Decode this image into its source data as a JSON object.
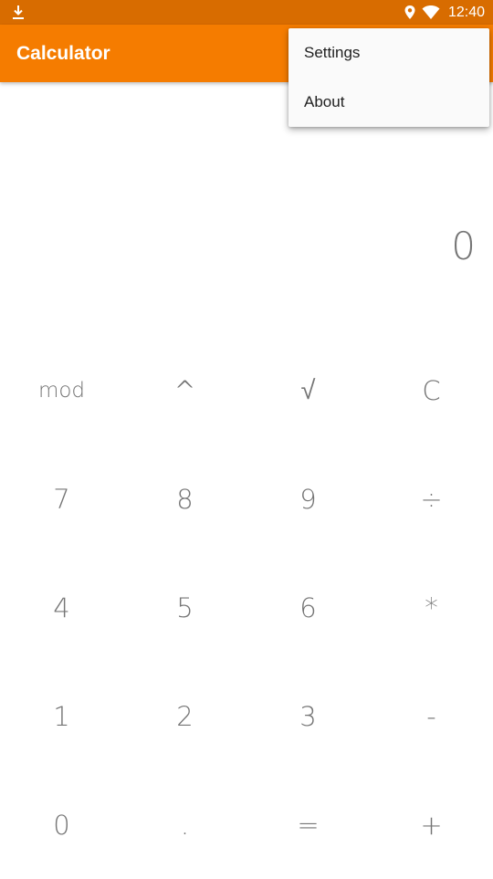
{
  "status_bar": {
    "time": "12:40",
    "icons": [
      "download-icon",
      "location-icon",
      "wifi-icon"
    ]
  },
  "app_bar": {
    "title": "Calculator",
    "color": "#f57c00"
  },
  "menu": {
    "items": [
      {
        "label": "Settings"
      },
      {
        "label": "About"
      }
    ]
  },
  "display": {
    "value": "0"
  },
  "keypad": {
    "rows": [
      [
        "mod",
        "^",
        "√",
        "C"
      ],
      [
        "7",
        "8",
        "9",
        "÷"
      ],
      [
        "4",
        "5",
        "6",
        "*"
      ],
      [
        "1",
        "2",
        "3",
        "-"
      ],
      [
        "0",
        ".",
        "=",
        "+"
      ]
    ]
  },
  "colors": {
    "status_bar": "#d86c00",
    "accent": "#f57c00",
    "key_text": "#757575"
  }
}
